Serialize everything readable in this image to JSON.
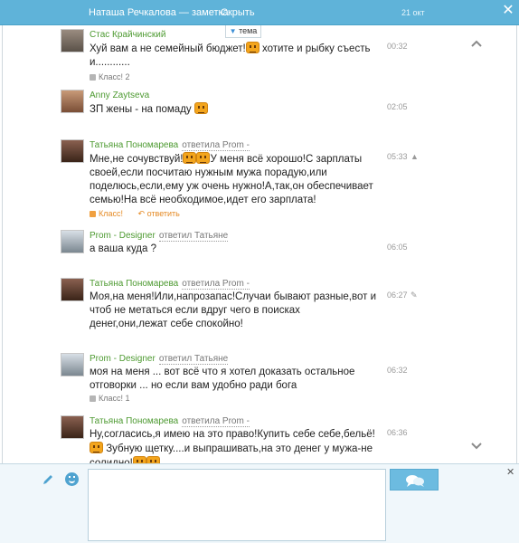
{
  "header": {
    "title": "Наташа Речкалова — заметка",
    "hide_label": "Скрыть",
    "date": "21 окт",
    "close_label": "✕"
  },
  "topic_tab": {
    "label": "тема",
    "arrow": "▼"
  },
  "messages": [
    {
      "author": "Стас Крайчинский",
      "reply_to": "",
      "text_parts": [
        "Хуй вам а не семейный бюджет!",
        "хотите и рыбку съесть и............"
      ],
      "time": "00:32",
      "like_label": "Класс! 2",
      "reply_label": ""
    },
    {
      "author": "Anny Zaytseva",
      "reply_to": "",
      "text_parts": [
        "ЗП жены - на помаду",
        ""
      ],
      "time": "02:05",
      "like_label": "",
      "reply_label": ""
    },
    {
      "author": "Татьяна Пономарева",
      "reply_to": "ответила Prom -",
      "text_parts": [
        "Мне,не сочувствуй!",
        "У меня всё хорошо!С зарплаты своей,если посчитаю нужным мужа порадую,или поделюсь,если,ему уж очень нужно!А,так,он обеспечивает семью!На всё необходимое,идет его зарплата!"
      ],
      "time": "05:33",
      "like_label": "Класс!",
      "reply_label": "ответить"
    },
    {
      "author": "Prom - Designer",
      "reply_to": "ответил Татьяне",
      "text_parts": [
        "а ваша куда ?",
        ""
      ],
      "time": "06:05",
      "like_label": "",
      "reply_label": ""
    },
    {
      "author": "Татьяна Пономарева",
      "reply_to": "ответила Prom -",
      "text_parts": [
        "Моя,на меня!Или,напрозапас!Случаи бывают разные,вот и чтоб не метаться если вдруг чего в поисках денег,они,лежат себе спокойно!",
        ""
      ],
      "time": "06:27",
      "like_label": "",
      "reply_label": ""
    },
    {
      "author": "Prom - Designer",
      "reply_to": "ответил Татьяне",
      "text_parts": [
        "моя на меня ... вот всё что я хотел доказать остальное отговорки ... но если вам удобно ради бога",
        ""
      ],
      "time": "06:32",
      "like_label": "Класс! 1",
      "reply_label": ""
    },
    {
      "author": "Татьяна Пономарева",
      "reply_to": "ответила Prom -",
      "text_parts": [
        "Ну,согласись,я имею на это право!Купить себе себе,бельё!",
        "Зубную щетку....и выпрашивать,на это денег у мужа-не солидно!"
      ],
      "time": "06:36",
      "like_label": "",
      "reply_label": ""
    }
  ],
  "colors": {
    "header_bg": "#5fb3d9",
    "author_green": "#4d9a31",
    "accent_orange": "#e58a24",
    "composer_bg": "#f0f7fb",
    "send_button": "#6cbbe0"
  },
  "icons": [
    "close-icon",
    "arrow-up-icon",
    "arrow-down-icon",
    "warning-icon",
    "pencil-icon",
    "emoji-icon",
    "send-chat-icon",
    "smiley-icon",
    "thumb-icon",
    "reply-arrow-icon"
  ]
}
